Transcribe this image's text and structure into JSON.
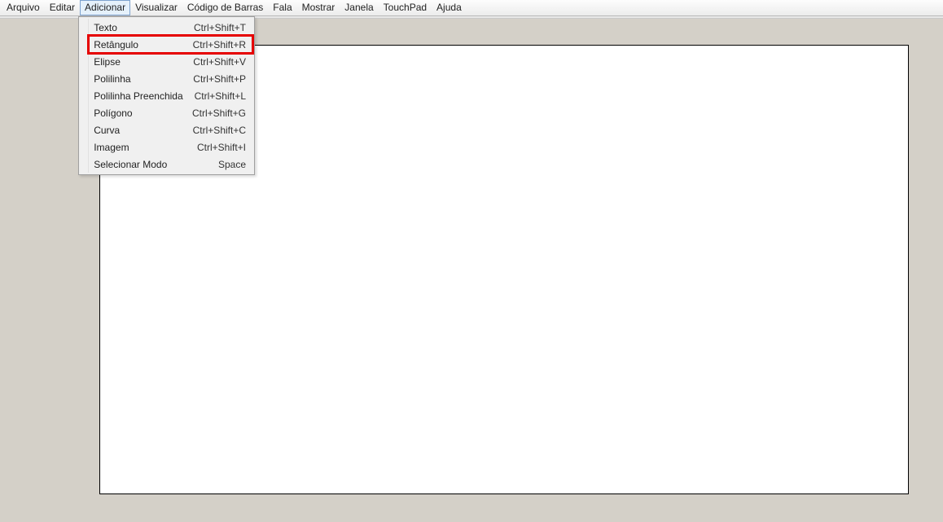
{
  "menubar": {
    "items": [
      {
        "label": "Arquivo"
      },
      {
        "label": "Editar"
      },
      {
        "label": "Adicionar",
        "active": true
      },
      {
        "label": "Visualizar"
      },
      {
        "label": "Código de Barras"
      },
      {
        "label": "Fala"
      },
      {
        "label": "Mostrar"
      },
      {
        "label": "Janela"
      },
      {
        "label": "TouchPad"
      },
      {
        "label": "Ajuda"
      }
    ]
  },
  "dropdown": {
    "items": [
      {
        "label": "Texto",
        "shortcut": "Ctrl+Shift+T"
      },
      {
        "label": "Retângulo",
        "shortcut": "Ctrl+Shift+R",
        "highlighted": true
      },
      {
        "label": "Elipse",
        "shortcut": "Ctrl+Shift+V"
      },
      {
        "label": "Polilinha",
        "shortcut": "Ctrl+Shift+P"
      },
      {
        "label": "Polilinha Preenchida",
        "shortcut": "Ctrl+Shift+L"
      },
      {
        "label": "Polígono",
        "shortcut": "Ctrl+Shift+G"
      },
      {
        "label": "Curva",
        "shortcut": "Ctrl+Shift+C"
      },
      {
        "label": "Imagem",
        "shortcut": "Ctrl+Shift+I"
      },
      {
        "label": "Selecionar Modo",
        "shortcut": "Space"
      }
    ]
  }
}
